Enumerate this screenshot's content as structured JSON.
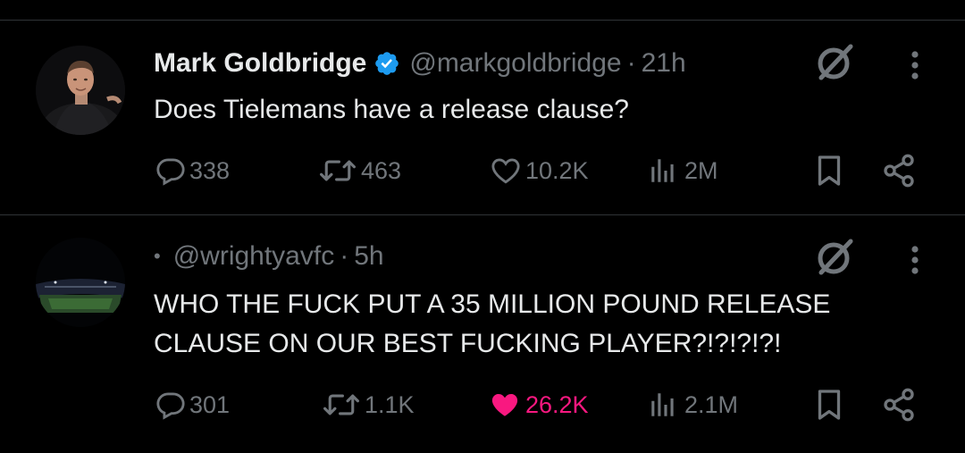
{
  "colors": {
    "background": "#000000",
    "text": "#e7e9ea",
    "muted": "#71767b",
    "verified": "#1d9bf0",
    "like_active": "#f91880"
  },
  "tweets": [
    {
      "name": "Mark Goldbridge",
      "verified": true,
      "handle": "@markgoldbridge",
      "separator": "·",
      "time": "21h",
      "text": "Does Tielemans have a release clause?",
      "replies": "338",
      "reposts": "463",
      "likes": "10.2K",
      "views": "2M",
      "liked": false,
      "icons": [
        "grok-icon",
        "more-icon",
        "reply-icon",
        "repost-icon",
        "like-icon",
        "views-icon",
        "bookmark-icon",
        "share-icon"
      ]
    },
    {
      "bullet": "•",
      "handle": "@wrightyavfc",
      "separator": "·",
      "time": "5h",
      "text": "WHO THE FUCK PUT A 35 MILLION POUND RELEASE CLAUSE ON OUR BEST FUCKING PLAYER?!?!?!?!",
      "replies": "301",
      "reposts": "1.1K",
      "likes": "26.2K",
      "views": "2.1M",
      "liked": true,
      "icons": [
        "grok-icon",
        "more-icon",
        "reply-icon",
        "repost-icon",
        "like-icon",
        "views-icon",
        "bookmark-icon",
        "share-icon"
      ]
    }
  ]
}
